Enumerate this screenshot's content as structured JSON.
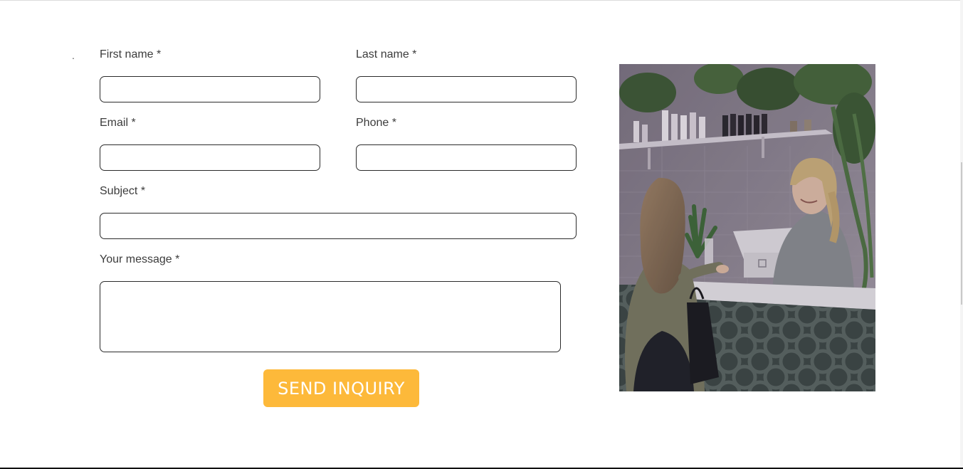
{
  "form": {
    "marker": ".",
    "first_name": {
      "label": "First name *",
      "value": "",
      "placeholder": ""
    },
    "last_name": {
      "label": "Last name *",
      "value": "",
      "placeholder": ""
    },
    "email": {
      "label": "Email *",
      "value": "",
      "placeholder": ""
    },
    "phone": {
      "label": "Phone *",
      "value": "",
      "placeholder": ""
    },
    "subject": {
      "label": "Subject *",
      "value": "",
      "placeholder": ""
    },
    "message": {
      "label": "Your message *",
      "value": "",
      "placeholder": ""
    },
    "submit_label": "SEND INQUIRY"
  },
  "photo": {
    "subject": "customer-at-shop-counter-photo"
  },
  "colors": {
    "button_bg": "#fdb93a",
    "button_text": "#ffffff",
    "label_text": "#3c3c3c",
    "field_border": "#2b2b2b"
  }
}
